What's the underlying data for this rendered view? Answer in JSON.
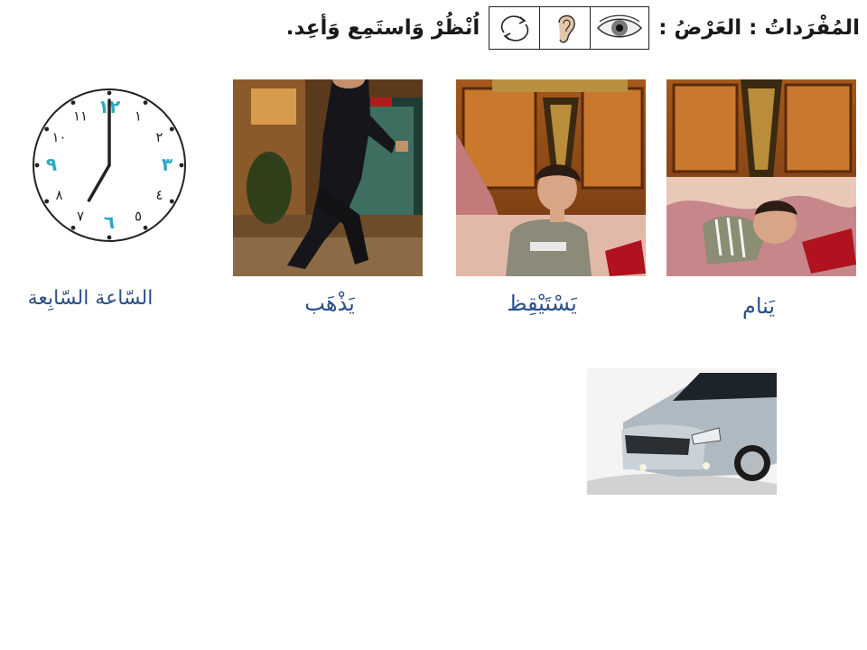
{
  "header": {
    "title": "المُفْرَداتُ : العَرْضُ :",
    "instruction": "اُنْظُرْ وَاستَمِع وَأعِد."
  },
  "icons": [
    "eye-icon",
    "ear-icon",
    "repeat-arrows-icon"
  ],
  "vocabulary": [
    {
      "word": "يَنام",
      "image": "boy-sleeping-in-bed"
    },
    {
      "word": "يَسْتَيْقِظ",
      "image": "boy-waking-up-in-bed"
    },
    {
      "word": "يَذْهَب",
      "image": "man-walking-out-door"
    },
    {
      "word": "السّاعة السّابِعة",
      "image": "clock-seven-oclock"
    }
  ],
  "clock": {
    "numerals": [
      "١٢",
      "١",
      "٢",
      "٣",
      "٤",
      "٥",
      "٦",
      "٧",
      "٨",
      "٩",
      "١٠",
      "١١"
    ],
    "highlight_color": "#2aa9c6",
    "numeral_color": "#222222",
    "hour": 7,
    "minute": 0
  },
  "extra_image": "silver-car",
  "colors": {
    "caption": "#2b4f86",
    "header_text": "#1a1a1a"
  }
}
